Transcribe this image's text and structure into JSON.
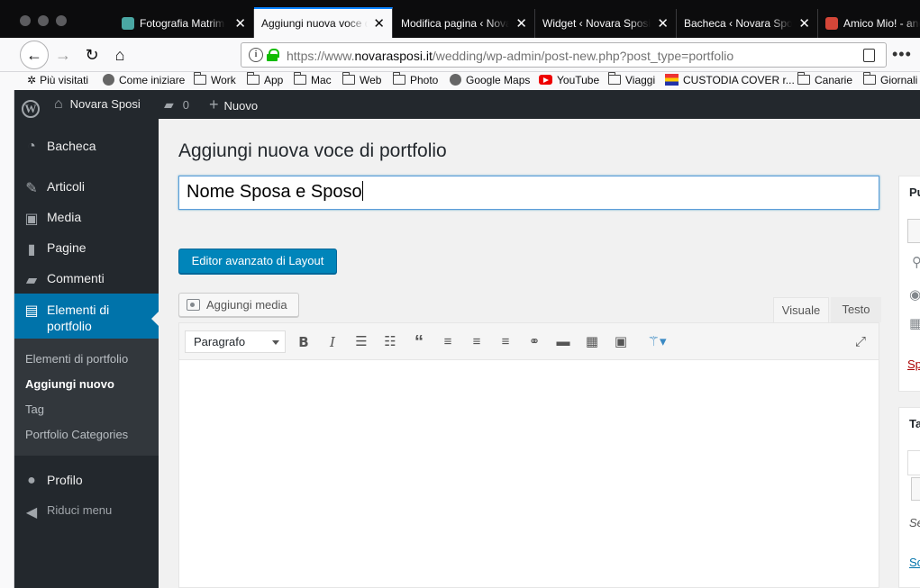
{
  "browser": {
    "tabs": [
      {
        "label": "Fotografia Matrimo",
        "close": "✕"
      },
      {
        "label": "Aggiungi nuova voce di",
        "close": "✕"
      },
      {
        "label": "Modifica pagina ‹ Nova",
        "close": "✕"
      },
      {
        "label": "Widget ‹ Novara Sposi",
        "close": "✕"
      },
      {
        "label": "Bacheca ‹ Novara Spos",
        "close": "✕"
      },
      {
        "label": "Amico Mio! - and",
        "close": ""
      }
    ],
    "url_base": "https://www.",
    "url_domain": "novarasposi.it",
    "url_path": "/wedding/wp-admin/post-new.php?post_type=portfolio",
    "bookmarks": [
      {
        "label": "Più visitati",
        "icon": "gear-icon"
      },
      {
        "label": "Come iniziare",
        "icon": "globe-icon"
      },
      {
        "label": "Work",
        "icon": "folder-icon"
      },
      {
        "label": "App",
        "icon": "folder-icon"
      },
      {
        "label": "Mac",
        "icon": "folder-icon"
      },
      {
        "label": "Web",
        "icon": "folder-icon"
      },
      {
        "label": "Photo",
        "icon": "folder-icon"
      },
      {
        "label": "Google Maps",
        "icon": "globe-icon"
      },
      {
        "label": "YouTube",
        "icon": "youtube-icon"
      },
      {
        "label": "Viaggi",
        "icon": "folder-icon"
      },
      {
        "label": "CUSTODIA COVER r...",
        "icon": "store-icon"
      },
      {
        "label": "Canarie",
        "icon": "folder-icon"
      },
      {
        "label": "Giornali",
        "icon": "folder-icon"
      }
    ]
  },
  "adminbar": {
    "site_name": "Novara Sposi",
    "comments_count": "0",
    "new_label": "Nuovo"
  },
  "sidebar": {
    "items": [
      {
        "label": "Bacheca",
        "icon": "dashboard-icon"
      },
      {
        "label": "Articoli",
        "icon": "pin-icon"
      },
      {
        "label": "Media",
        "icon": "media-icon"
      },
      {
        "label": "Pagine",
        "icon": "page-icon"
      },
      {
        "label": "Commenti",
        "icon": "comment-icon"
      },
      {
        "label": "Elementi di portfolio",
        "icon": "portfolio-icon"
      },
      {
        "label": "Profilo",
        "icon": "user-icon"
      },
      {
        "label": "Riduci menu",
        "icon": "collapse-icon"
      }
    ],
    "submenu": [
      "Elementi di portfolio",
      "Aggiungi nuovo",
      "Tag",
      "Portfolio Categories"
    ]
  },
  "main": {
    "page_title": "Aggiungi nuova voce di portfolio",
    "post_title": "Nome Sposa e Sposo",
    "layout_button": "Editor avanzato di Layout",
    "add_media": "Aggiungi media",
    "tab_visual": "Visuale",
    "tab_text": "Testo",
    "format_select": "Paragrafo"
  },
  "right": {
    "publish_fragment": "Pu",
    "trash_fragment": "Sp",
    "tags_fragment": "Ta",
    "sep_fragment": "Se",
    "link_fragment": "Sc"
  },
  "colors": {
    "accent": "#0073aa",
    "button_primary": "#0085ba",
    "adminbar": "#23282d",
    "browser_tab_active_border": "#0a84ff",
    "lock_green": "#12bc00"
  }
}
